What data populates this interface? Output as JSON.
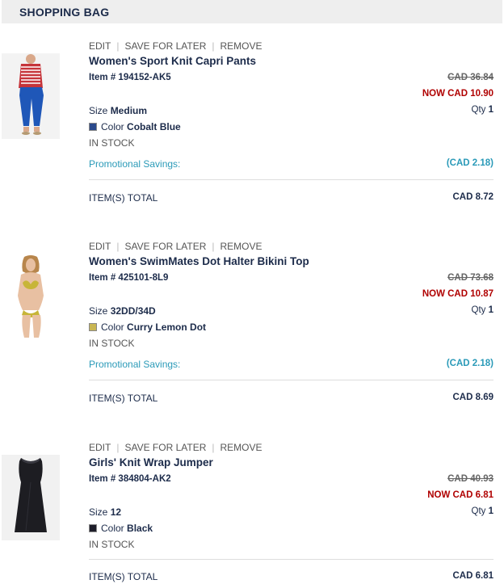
{
  "header": {
    "title": "SHOPPING BAG"
  },
  "items": [
    {
      "actions": {
        "edit": "EDIT",
        "save": "SAVE FOR LATER",
        "remove": "REMOVE"
      },
      "name": "Women's Sport Knit Capri Pants",
      "item_no": "Item # 194152-AK5",
      "was_price": "CAD 36.84",
      "now_price": "NOW CAD 10.90",
      "size_label": "Size",
      "size": "Medium",
      "qty_label": "Qty",
      "qty": "1",
      "color_label": "Color",
      "color": "Cobalt Blue",
      "swatch": "#2b4a8c",
      "stock": "IN STOCK",
      "promo_label": "Promotional Savings:",
      "promo_value": "(CAD 2.18)",
      "total_label": "ITEM(S) TOTAL",
      "total_value": "CAD 8.72"
    },
    {
      "actions": {
        "edit": "EDIT",
        "save": "SAVE FOR LATER",
        "remove": "REMOVE"
      },
      "name": "Women's SwimMates Dot Halter Bikini Top",
      "item_no": "Item # 425101-8L9",
      "was_price": "CAD 73.68",
      "now_price": "NOW CAD 10.87",
      "size_label": "Size",
      "size": "32DD/34D",
      "qty_label": "Qty",
      "qty": "1",
      "color_label": "Color",
      "color": "Curry Lemon Dot",
      "swatch": "#c9b653",
      "stock": "IN STOCK",
      "promo_label": "Promotional Savings:",
      "promo_value": "(CAD 2.18)",
      "total_label": "ITEM(S) TOTAL",
      "total_value": "CAD 8.69"
    },
    {
      "actions": {
        "edit": "EDIT",
        "save": "SAVE FOR LATER",
        "remove": "REMOVE"
      },
      "name": "Girls' Knit Wrap Jumper",
      "item_no": "Item # 384804-AK2",
      "was_price": "CAD 40.93",
      "now_price": "NOW CAD 6.81",
      "size_label": "Size",
      "size": "12",
      "qty_label": "Qty",
      "qty": "1",
      "color_label": "Color",
      "color": "Black",
      "swatch": "#1e1e2a",
      "stock": "IN STOCK",
      "total_label": "ITEM(S) TOTAL",
      "total_value": "CAD 6.81"
    }
  ]
}
